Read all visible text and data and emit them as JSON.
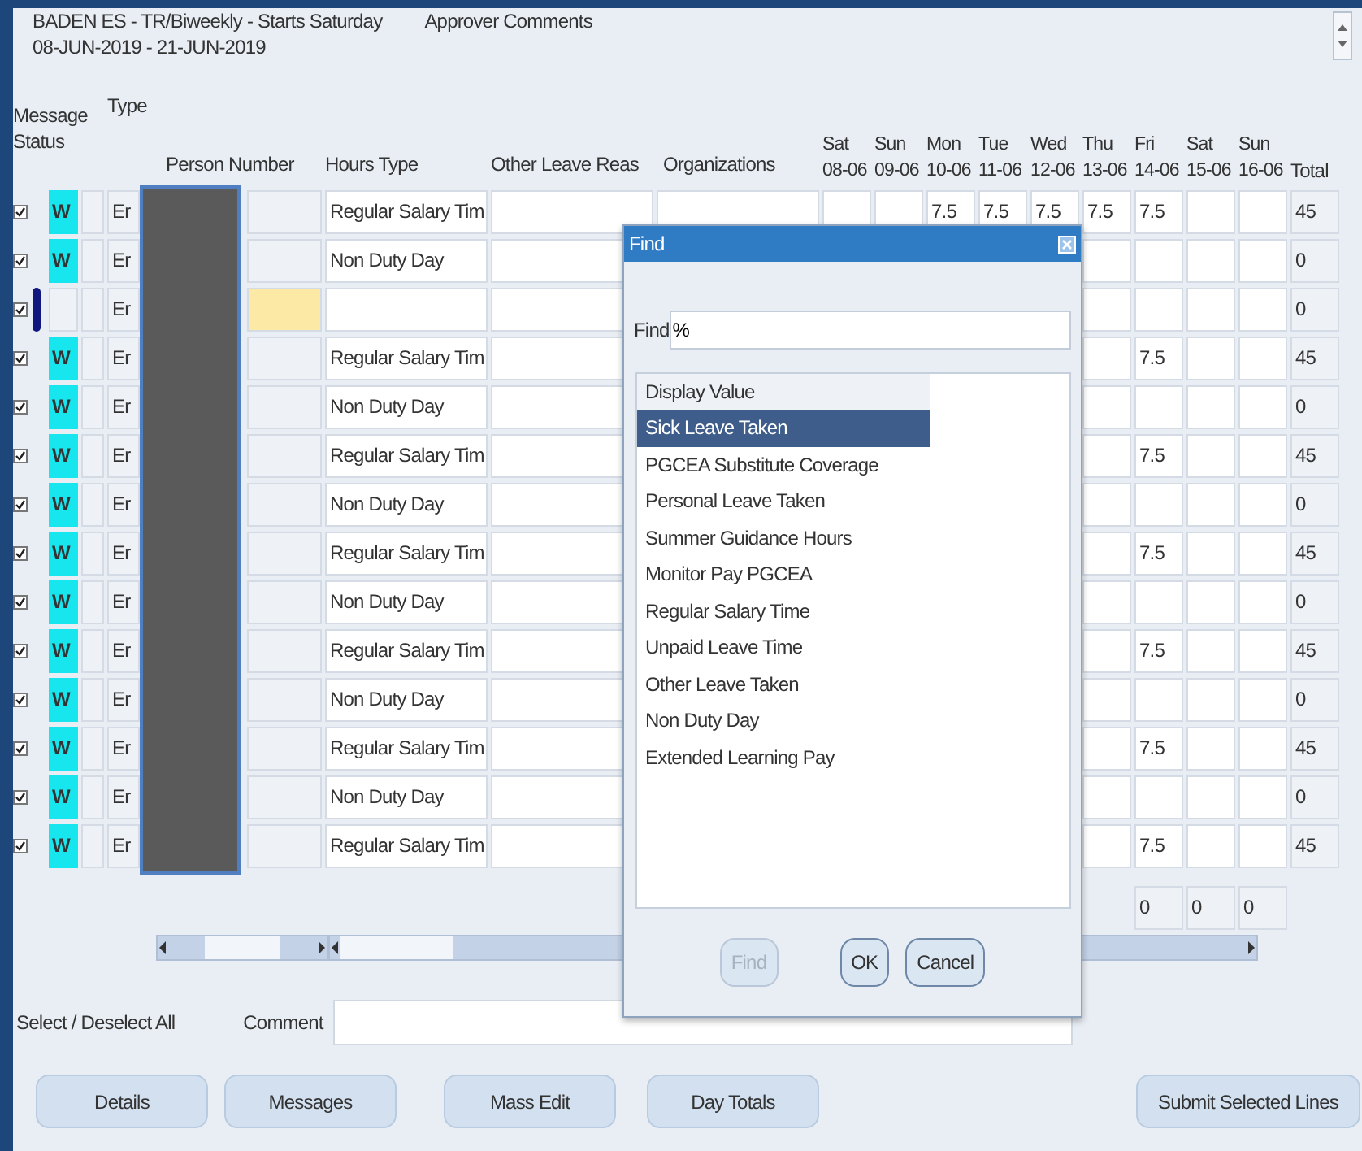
{
  "header": {
    "title": "BADEN ES - TR/Biweekly - Starts Saturday",
    "period": "08-JUN-2019 - 21-JUN-2019",
    "approver_label": "Approver Comments"
  },
  "table": {
    "columns": {
      "message": "Message",
      "status": "Status",
      "type": "Type",
      "person": "Person Number",
      "hours_type": "Hours Type",
      "other_leave": "Other Leave Reas",
      "organizations": "Organizations",
      "total": "Total"
    },
    "days": [
      {
        "day": "Sat",
        "date": "08-06"
      },
      {
        "day": "Sun",
        "date": "09-06"
      },
      {
        "day": "Mon",
        "date": "10-06"
      },
      {
        "day": "Tue",
        "date": "11-06"
      },
      {
        "day": "Wed",
        "date": "12-06"
      },
      {
        "day": "Thu",
        "date": "13-06"
      },
      {
        "day": "Fri",
        "date": "14-06"
      },
      {
        "day": "Sat",
        "date": "15-06"
      },
      {
        "day": "Sun",
        "date": "16-06"
      }
    ],
    "rows": [
      {
        "checked": true,
        "current": false,
        "status": "W",
        "type": "Er",
        "hours_type": "Regular Salary Tim",
        "hours": {
          "mon": "7.5",
          "tue": "7.5",
          "wed": "7.5",
          "thu": "7.5",
          "fri": "7.5"
        },
        "total": "45"
      },
      {
        "checked": true,
        "current": false,
        "status": "W",
        "type": "Er",
        "hours_type": "Non Duty Day",
        "total": "0"
      },
      {
        "checked": true,
        "current": true,
        "type": "Er",
        "total": "0"
      },
      {
        "checked": true,
        "current": false,
        "status": "W",
        "type": "Er",
        "hours_type": "Regular Salary Tim",
        "hours": {
          "fri": "7.5"
        },
        "total": "45"
      },
      {
        "checked": true,
        "current": false,
        "status": "W",
        "type": "Er",
        "hours_type": "Non Duty Day",
        "total": "0"
      },
      {
        "checked": true,
        "current": false,
        "status": "W",
        "type": "Er",
        "hours_type": "Regular Salary Tim",
        "hours": {
          "fri": "7.5"
        },
        "total": "45"
      },
      {
        "checked": true,
        "current": false,
        "status": "W",
        "type": "Er",
        "hours_type": "Non Duty Day",
        "total": "0"
      },
      {
        "checked": true,
        "current": false,
        "status": "W",
        "type": "Er",
        "hours_type": "Regular Salary Tim",
        "hours": {
          "fri": "7.5"
        },
        "total": "45"
      },
      {
        "checked": true,
        "current": false,
        "status": "W",
        "type": "Er",
        "hours_type": "Non Duty Day",
        "total": "0"
      },
      {
        "checked": true,
        "current": false,
        "status": "W",
        "type": "Er",
        "hours_type": "Regular Salary Tim",
        "hours": {
          "fri": "7.5"
        },
        "total": "45"
      },
      {
        "checked": true,
        "current": false,
        "status": "W",
        "type": "Er",
        "hours_type": "Non Duty Day",
        "total": "0"
      },
      {
        "checked": true,
        "current": false,
        "status": "W",
        "type": "Er",
        "hours_type": "Regular Salary Tim",
        "hours": {
          "fri": "7.5"
        },
        "total": "45"
      },
      {
        "checked": true,
        "current": false,
        "status": "W",
        "type": "Er",
        "hours_type": "Non Duty Day",
        "total": "0"
      },
      {
        "checked": true,
        "current": false,
        "status": "W",
        "type": "Er",
        "hours_type": "Regular Salary Tim",
        "hours": {
          "fri": "7.5"
        },
        "total": "45"
      }
    ],
    "day_totals": {
      "fri": "0",
      "sat2": "0",
      "sun2": "0"
    }
  },
  "select_all": "Select / Deselect All",
  "comment": {
    "label": "Comment"
  },
  "buttons": [
    {
      "label": "Details"
    },
    {
      "label": "Messages"
    },
    {
      "label": "Mass Edit"
    },
    {
      "label": "Day Totals"
    },
    {
      "label": "Submit Selected Lines"
    }
  ],
  "find_dialog": {
    "title": "Find",
    "field_label": "Find",
    "field_value": "%",
    "list_header": "Display Value",
    "items": [
      {
        "label": "Sick Leave Taken",
        "selected": true
      },
      {
        "label": "PGCEA Substitute Coverage",
        "selected": false
      },
      {
        "label": "Personal Leave Taken",
        "selected": false
      },
      {
        "label": "Summer Guidance Hours",
        "selected": false
      },
      {
        "label": "Monitor Pay PGCEA",
        "selected": false
      },
      {
        "label": "Regular Salary Time",
        "selected": false
      },
      {
        "label": "Unpaid Leave Time",
        "selected": false
      },
      {
        "label": "Other Leave Taken",
        "selected": false
      },
      {
        "label": "Non Duty Day",
        "selected": false
      },
      {
        "label": "Extended Learning Pay",
        "selected": false
      }
    ],
    "buttons": [
      {
        "label": "Find",
        "disabled": true
      },
      {
        "label": "OK",
        "disabled": false
      },
      {
        "label": "Cancel",
        "disabled": false
      }
    ]
  }
}
